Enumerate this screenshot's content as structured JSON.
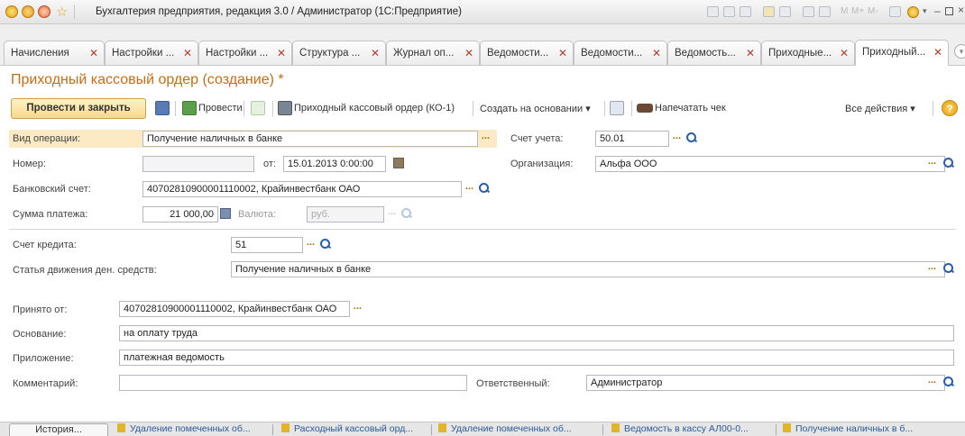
{
  "window": {
    "title": "Бухгалтерия предприятия, редакция 3.0 / Администратор  (1С:Предприятие)"
  },
  "tabs": [
    {
      "label": "Начисления"
    },
    {
      "label": "Настройки ..."
    },
    {
      "label": "Настройки ..."
    },
    {
      "label": "Структура ..."
    },
    {
      "label": "Журнал оп..."
    },
    {
      "label": "Ведомости..."
    },
    {
      "label": "Ведомости..."
    },
    {
      "label": "Ведомость..."
    },
    {
      "label": "Приходные..."
    },
    {
      "label": "Приходный..."
    }
  ],
  "form": {
    "title": "Приходный кассовый ордер (создание) *"
  },
  "toolbar": {
    "post_close": "Провести и закрыть",
    "post": "Провести",
    "print_form": "Приходный кассовый ордер (КО-1)",
    "create_based": "Создать на основании",
    "print_check": "Напечатать чек",
    "all_actions": "Все действия",
    "help": "?"
  },
  "fields": {
    "operation_type": {
      "label": "Вид операции:",
      "value": "Получение наличных в банке"
    },
    "account": {
      "label": "Счет учета:",
      "value": "50.01"
    },
    "number": {
      "label": "Номер:",
      "value": ""
    },
    "date": {
      "label": "от:",
      "value": "15.01.2013  0:00:00"
    },
    "organization": {
      "label": "Организация:",
      "value": "Альфа ООО"
    },
    "bank_account": {
      "label": "Банковский счет:",
      "value": "40702810900001110002, Крайинвестбанк ОАО"
    },
    "payment_sum": {
      "label": "Сумма платежа:",
      "value": "21 000,00"
    },
    "currency": {
      "label": "Валюта:",
      "value": "руб."
    },
    "credit_account": {
      "label": "Счет кредита:",
      "value": "51"
    },
    "cash_flow_item": {
      "label": "Статья движения ден. средств:",
      "value": "Получение  наличных в банке"
    },
    "received_from": {
      "label": "Принято от:",
      "value": "40702810900001110002, Крайинвестбанк ОАО"
    },
    "basis": {
      "label": "Основание:",
      "value": "на оплату труда"
    },
    "attachment": {
      "label": "Приложение:",
      "value": "платежная ведомость"
    },
    "comment": {
      "label": "Комментарий:",
      "value": ""
    },
    "responsible": {
      "label": "Ответственный:",
      "value": "Администратор"
    }
  },
  "bottom": {
    "history": "История...",
    "tasks": [
      "Удаление помеченных об...",
      "Расходный кассовый орд...",
      "Удаление помеченных об...",
      "Ведомость в кассу АЛ00-0...",
      "Получение  наличных в б..."
    ]
  }
}
